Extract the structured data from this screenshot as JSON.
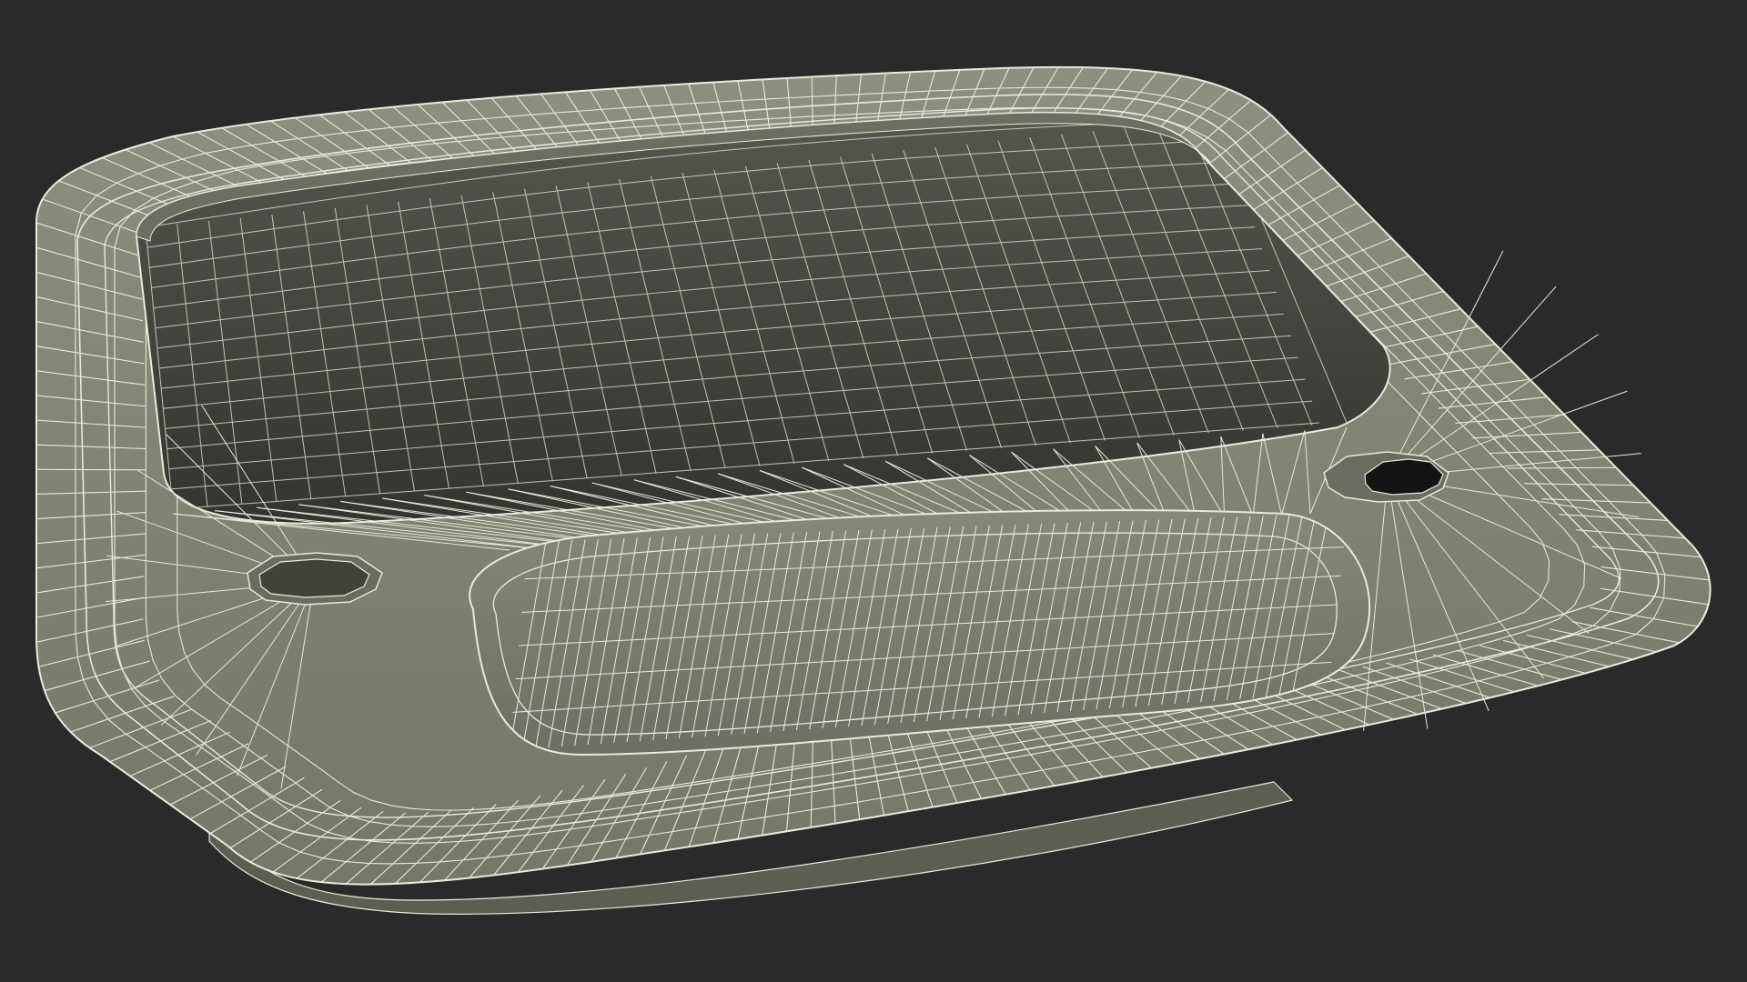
{
  "scene": {
    "subject": "sink-wireframe-render",
    "colors": {
      "background": "#2a2a2a",
      "surface_light": "#8c8c7c",
      "surface_mid": "#7d7d6d",
      "surface_dark": "#4b4b43",
      "basin_inner": "#3f403a",
      "wire": "#e9e9dc",
      "hole": "#1a1a1a"
    },
    "icons": []
  }
}
